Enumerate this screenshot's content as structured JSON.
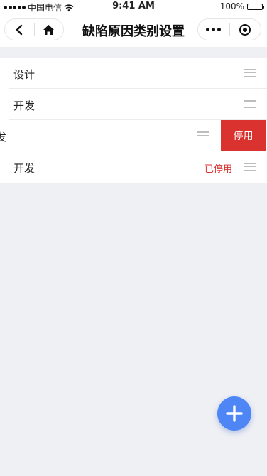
{
  "status_bar": {
    "carrier": "中国电信",
    "time": "9:41 AM",
    "battery": "100%"
  },
  "nav": {
    "title": "缺陷原因类别设置",
    "back_icon": "chevron-left-icon",
    "home_icon": "home-icon",
    "more_icon": "more-dots-icon",
    "close_icon": "target-circle-icon"
  },
  "items": [
    {
      "label": "设计",
      "status": ""
    },
    {
      "label": "开发",
      "status": ""
    },
    {
      "label": "发",
      "status": "",
      "swipe_action": "停用"
    },
    {
      "label": "开发",
      "status": "已停用"
    }
  ],
  "fab": {
    "icon": "plus-icon"
  },
  "colors": {
    "accent": "#4e86f5",
    "danger": "#d9322f",
    "background": "#eff0f4"
  }
}
